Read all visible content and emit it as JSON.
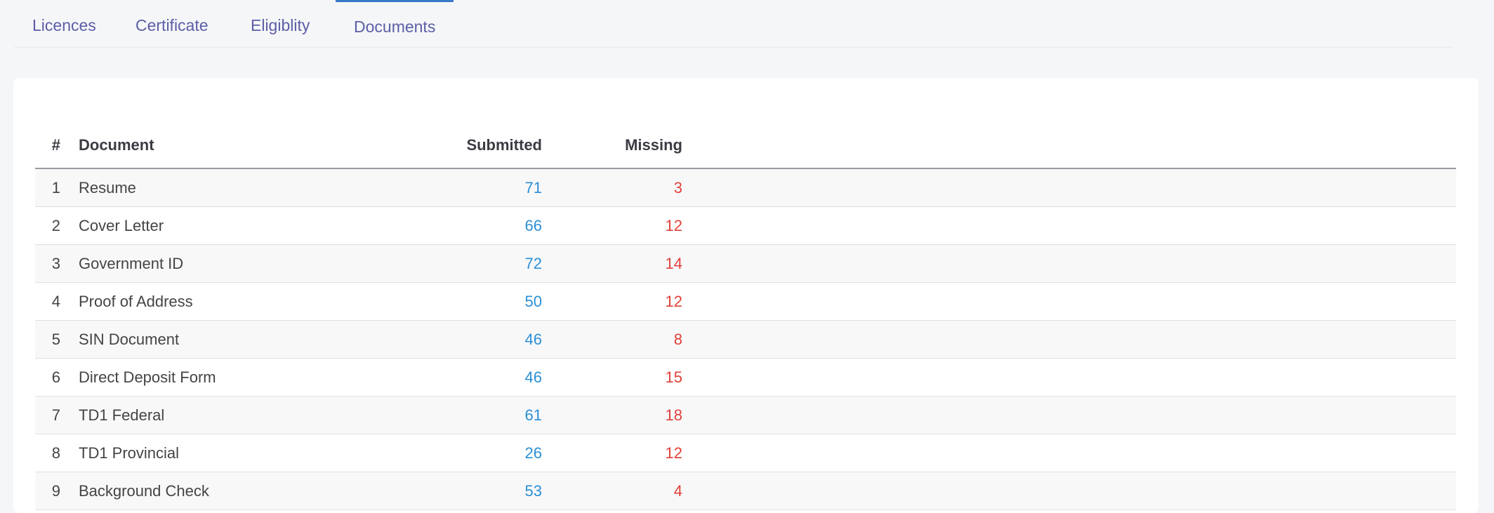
{
  "tabs": [
    {
      "label": "Licences",
      "active": false
    },
    {
      "label": "Certificate",
      "active": false
    },
    {
      "label": "Eligiblity",
      "active": false
    },
    {
      "label": "Documents",
      "active": true
    }
  ],
  "table": {
    "headers": {
      "num": "#",
      "document": "Document",
      "submitted": "Submitted",
      "missing": "Missing"
    },
    "rows": [
      {
        "num": "1",
        "document": "Resume",
        "submitted": "71",
        "missing": "3"
      },
      {
        "num": "2",
        "document": "Cover Letter",
        "submitted": "66",
        "missing": "12"
      },
      {
        "num": "3",
        "document": "Government ID",
        "submitted": "72",
        "missing": "14"
      },
      {
        "num": "4",
        "document": "Proof of Address",
        "submitted": "50",
        "missing": "12"
      },
      {
        "num": "5",
        "document": "SIN Document",
        "submitted": "46",
        "missing": "8"
      },
      {
        "num": "6",
        "document": "Direct Deposit Form",
        "submitted": "46",
        "missing": "15"
      },
      {
        "num": "7",
        "document": "TD1 Federal",
        "submitted": "61",
        "missing": "18"
      },
      {
        "num": "8",
        "document": "TD1 Provincial",
        "submitted": "26",
        "missing": "12"
      },
      {
        "num": "9",
        "document": "Background Check",
        "submitted": "53",
        "missing": "4"
      }
    ]
  },
  "colors": {
    "submitted": "#2b8fd6",
    "missing": "#e0413a",
    "tab": "#5b5ea6",
    "active_tab_border": "#3a78c9"
  }
}
